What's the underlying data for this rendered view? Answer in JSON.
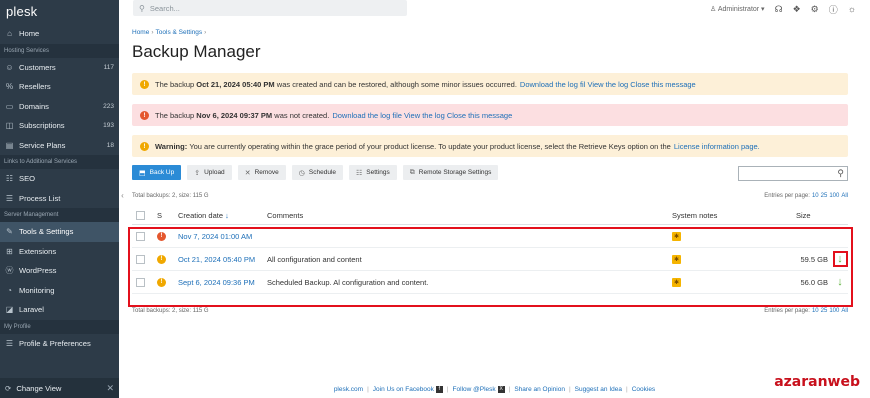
{
  "sidebar": {
    "logo": "plesk",
    "home": "Home",
    "section_hosting": "Hosting Services",
    "customers": {
      "label": "Customers",
      "count": "117"
    },
    "resellers": {
      "label": "Resellers"
    },
    "domains": {
      "label": "Domains",
      "count": "223"
    },
    "subscriptions": {
      "label": "Subscriptions",
      "count": "193"
    },
    "service_plans": {
      "label": "Service Plans",
      "count": "18"
    },
    "section_links": "Links to Additional Services",
    "seo": "SEO",
    "process_list": "Process List",
    "section_server": "Server Management",
    "tools_settings": "Tools & Settings",
    "extensions": "Extensions",
    "wordpress": "WordPress",
    "monitoring": "Monitoring",
    "laravel": "Laravel",
    "section_profile": "My Profile",
    "profile_prefs": "Profile & Preferences",
    "change_view": "Change View"
  },
  "topbar": {
    "search_placeholder": "Search...",
    "user": "Administrator"
  },
  "breadcrumb": {
    "home": "Home",
    "tools": "Tools & Settings"
  },
  "page_title": "Backup Manager",
  "alerts": {
    "a1_prefix": "The backup",
    "a1_date": "Oct 21, 2024 05:40 PM",
    "a1_text": "was created and can be restored, although some minor issues occurred.",
    "a1_links": "Download the log fil View the log Close this message",
    "a2_prefix": "The backup",
    "a2_date": "Nov 6, 2024 09:37 PM",
    "a2_text": "was not created.",
    "a2_links": "Download the log file View the log Close this message",
    "a3_bold": "Warning:",
    "a3_text": "You are currently operating within the grace period of your product license. To update your product license, select the Retrieve Keys option on the",
    "a3_link": "License information page."
  },
  "toolbar": {
    "backup": "Back Up",
    "upload": "Upload",
    "remove": "Remove",
    "schedule": "Schedule",
    "settings": "Settings",
    "remote": "Remote Storage Settings"
  },
  "summary": "Total backups: 2, size: 115 G",
  "summary_bottom": "Total backups: 2, size: 115 G",
  "per_page": {
    "label": "Entries per page:",
    "opt1": "10",
    "opt2": "25",
    "opt3": "100",
    "opt4": "All"
  },
  "table": {
    "col_s": "S",
    "col_date": "Creation date",
    "col_comments": "Comments",
    "col_notes": "System notes",
    "col_size": "Size",
    "rows": [
      {
        "date": "Nov 7, 2024 01:00 AM",
        "comments": "",
        "size": ""
      },
      {
        "date": "Oct 21, 2024 05:40 PM",
        "comments": "All configuration and content",
        "size": "59.5 GB"
      },
      {
        "date": "Sept 6, 2024 09:36 PM",
        "comments": "Scheduled Backup. Al configuration and content.",
        "size": "56.0 GB"
      }
    ]
  },
  "footer": {
    "plesk": "plesk.com",
    "facebook": "Join Us on Facebook",
    "follow": "Follow @Plesk",
    "opinion": "Share an Opinion",
    "idea": "Suggest an Idea",
    "cookies": "Cookies"
  },
  "watermark": "azaranweb"
}
